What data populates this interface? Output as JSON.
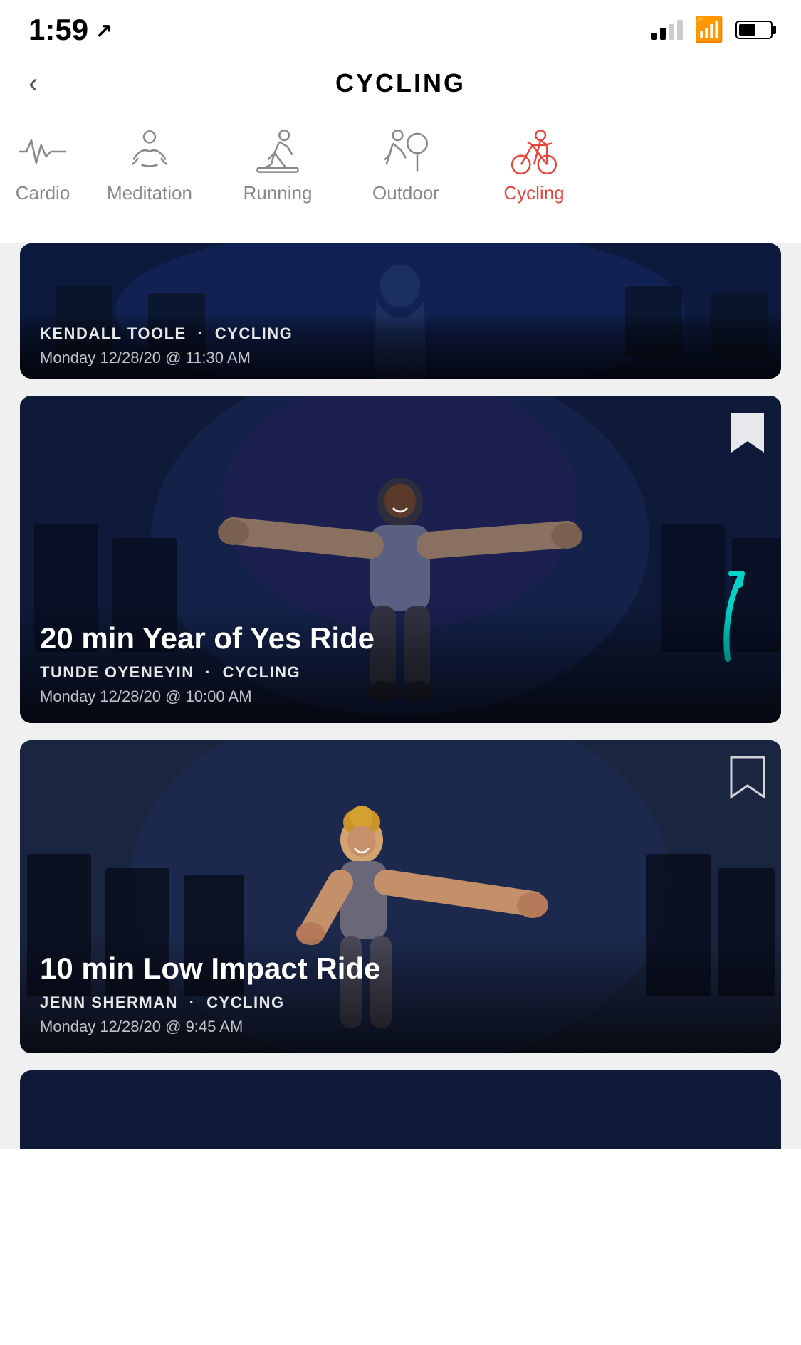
{
  "status": {
    "time": "1:59",
    "location_arrow": "↗"
  },
  "header": {
    "back_label": "<",
    "title": "CYCLING"
  },
  "categories": [
    {
      "id": "cardio",
      "label": "Cardio",
      "partial": true,
      "active": false
    },
    {
      "id": "meditation",
      "label": "Meditation",
      "active": false
    },
    {
      "id": "running",
      "label": "Running",
      "active": false
    },
    {
      "id": "outdoor",
      "label": "Outdoor",
      "active": false
    },
    {
      "id": "cycling",
      "label": "Cycling",
      "active": true
    }
  ],
  "cards": [
    {
      "id": "kendall",
      "partial_top": true,
      "instructor": "KENDALL TOOLE",
      "category": "CYCLING",
      "datetime": "Monday 12/28/20 @ 11:30 AM",
      "bookmarked": false
    },
    {
      "id": "tunde",
      "title": "20 min Year of Yes Ride",
      "instructor": "TUNDE OYENEYIN",
      "category": "CYCLING",
      "datetime": "Monday 12/28/20 @ 10:00 AM",
      "bookmarked": true,
      "has_arrow": true
    },
    {
      "id": "jenn",
      "title": "10 min Low Impact Ride",
      "instructor": "JENN SHERMAN",
      "category": "CYCLING",
      "datetime": "Monday 12/28/20 @ 9:45 AM",
      "bookmarked": false
    }
  ],
  "labels": {
    "dot_separator": "·"
  }
}
